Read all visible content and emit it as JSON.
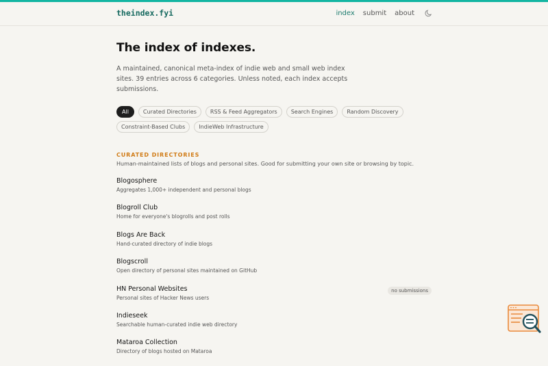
{
  "header": {
    "logo": "theindex.fyi",
    "nav": [
      {
        "label": "index",
        "active": true
      },
      {
        "label": "submit",
        "active": false
      },
      {
        "label": "about",
        "active": false
      }
    ],
    "theme_toggle_icon": "moon-icon"
  },
  "main": {
    "title": "The index of indexes.",
    "intro": "A maintained, canonical meta-index of indie web and small web index sites. 39 entries across 6 categories. Unless noted, each index accepts submissions.",
    "filters": [
      {
        "label": "All",
        "active": true
      },
      {
        "label": "Curated Directories",
        "active": false
      },
      {
        "label": "RSS & Feed Aggregators",
        "active": false
      },
      {
        "label": "Search Engines",
        "active": false
      },
      {
        "label": "Random Discovery",
        "active": false
      },
      {
        "label": "Constraint-Based Clubs",
        "active": false
      },
      {
        "label": "IndieWeb Infrastructure",
        "active": false
      }
    ],
    "section": {
      "title": "CURATED DIRECTORIES",
      "description": "Human-maintained lists of blogs and personal sites. Good for submitting your own site or browsing by topic.",
      "entries": [
        {
          "name": "Blogosphere",
          "description": "Aggregates 1,000+ independent and personal blogs",
          "badge": ""
        },
        {
          "name": "Blogroll Club",
          "description": "Home for everyone's blogrolls and post rolls",
          "badge": ""
        },
        {
          "name": "Blogs Are Back",
          "description": "Hand-curated directory of indie blogs",
          "badge": ""
        },
        {
          "name": "Blogscroll",
          "description": "Open directory of personal sites maintained on GitHub",
          "badge": ""
        },
        {
          "name": "HN Personal Websites",
          "description": "Personal sites of Hacker News users",
          "badge": "no submissions"
        },
        {
          "name": "Indieseek",
          "description": "Searchable human-curated indie web directory",
          "badge": ""
        },
        {
          "name": "Mataroa Collection",
          "description": "Directory of blogs hosted on Mataroa",
          "badge": ""
        }
      ]
    }
  },
  "colors": {
    "accent_teal": "#13b5a2",
    "logo": "#15695f",
    "section_orange": "#d07a14",
    "background": "#f6f5f1"
  },
  "corner_widget_icon": "magnifier-window-icon"
}
